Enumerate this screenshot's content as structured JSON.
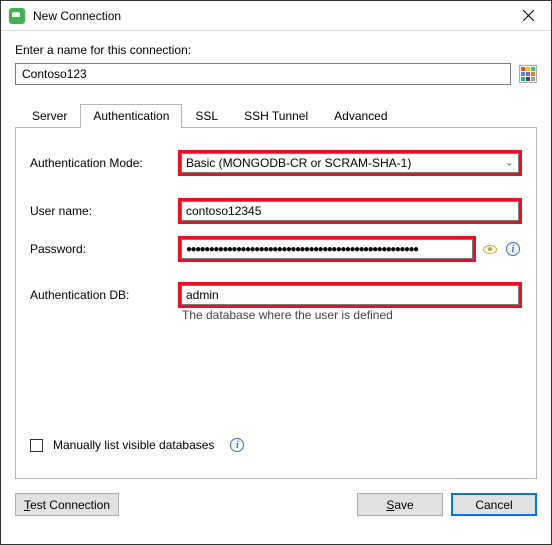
{
  "window": {
    "title": "New Connection"
  },
  "prompt": "Enter a name for this connection:",
  "connection_name": "Contoso123",
  "tabs": {
    "server": "Server",
    "authentication": "Authentication",
    "ssl": "SSL",
    "ssh_tunnel": "SSH Tunnel",
    "advanced": "Advanced",
    "active": "authentication"
  },
  "auth": {
    "mode_label": "Authentication Mode:",
    "mode_value": "Basic (MONGODB-CR or SCRAM-SHA-1)",
    "username_label": "User name:",
    "username_value": "contoso12345",
    "password_label": "Password:",
    "password_value": "●●●●●●●●●●●●●●●●●●●●●●●●●●●●●●●●●●●●●●●●●●●●●●●●●●●",
    "authdb_label": "Authentication DB:",
    "authdb_value": "admin",
    "authdb_helper": "The database where the user is defined",
    "manual_db_label": "Manually list visible databases"
  },
  "footer": {
    "test": "est Connection",
    "test_u": "T",
    "save": "ave",
    "save_u": "S",
    "cancel": "Cancel"
  },
  "colors": {
    "highlight": "#e81123",
    "primary": "#0078d7"
  }
}
